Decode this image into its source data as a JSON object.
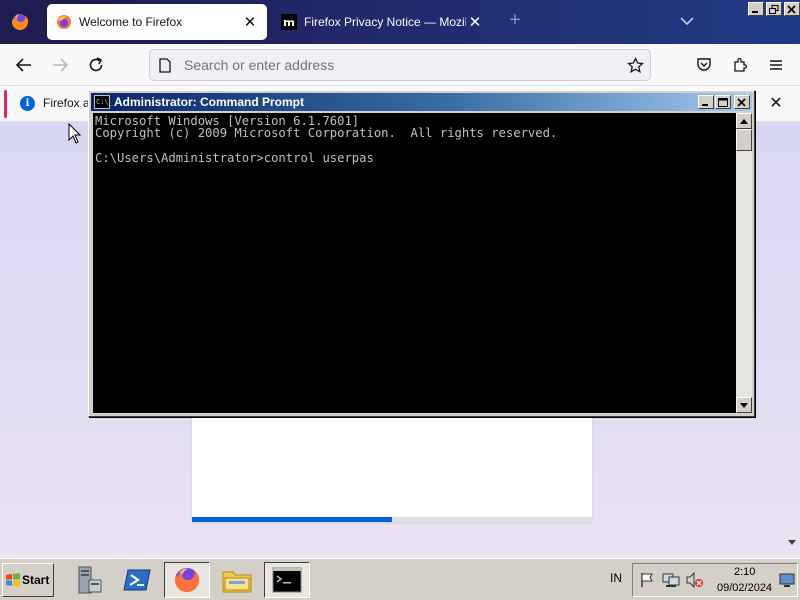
{
  "browser": {
    "tabs": [
      {
        "title": "Welcome to Firefox",
        "active": true
      },
      {
        "title": "Firefox Privacy Notice — Mozilla",
        "active": false
      }
    ],
    "new_tab_symbol": "+",
    "close_symbol": "✕",
    "urlbar": {
      "placeholder": "Search or enter address",
      "value": ""
    },
    "notification": {
      "text": "Firefox a",
      "close_symbol": "✕"
    },
    "onboarding": {
      "progress_fraction": 0.5
    },
    "colors": {
      "accent": "#0061e0",
      "notification_accent": "#e22850",
      "tabstrip": "#22286b"
    }
  },
  "cmd": {
    "title": "Administrator: Command Prompt",
    "icon_text": "C:\\_",
    "lines": [
      "Microsoft Windows [Version 6.1.7601]",
      "Copyright (c) 2009 Microsoft Corporation.  All rights reserved.",
      "",
      "C:\\Users\\Administrator>control userpas"
    ],
    "colors": {
      "background": "#000000",
      "text": "#c0c0c0",
      "title_bar": "#0a246a"
    }
  },
  "taskbar": {
    "start_label": "Start",
    "pinned": [
      "server-manager-icon",
      "powershell-icon",
      "firefox-icon",
      "explorer-icon",
      "cmd-icon"
    ],
    "tray": {
      "language": "IN",
      "time": "2:10",
      "date": "09/02/2024"
    }
  }
}
